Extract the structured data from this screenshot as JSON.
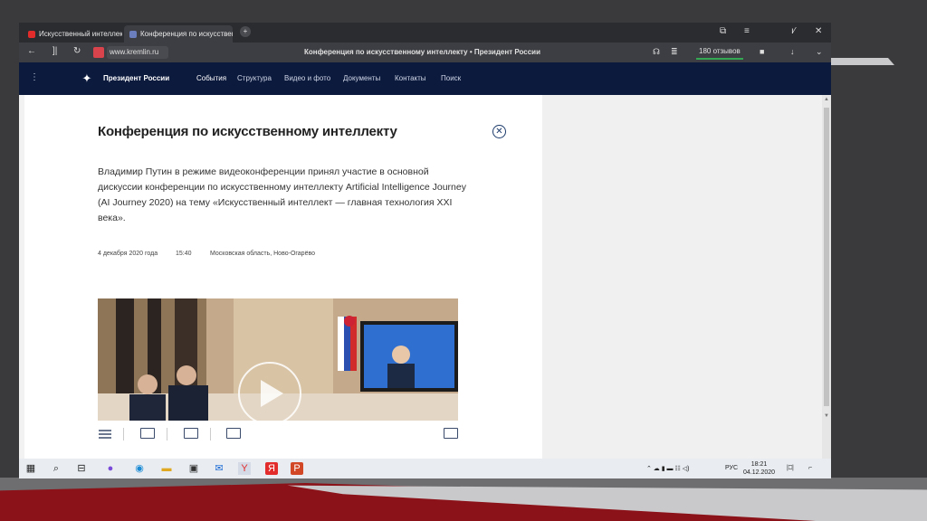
{
  "tabs": [
    {
      "label": "Искусственный интеллект",
      "favicon_color": "#e22b2b"
    },
    {
      "label": "Конференция по искусственному",
      "favicon_color": "#6b7fbf"
    }
  ],
  "address": {
    "url": "www.kremlin.ru",
    "page_title": "Конференция по искусственному интеллекту • Президент России",
    "reviews": "180 отзывов"
  },
  "site": {
    "brand": "Президент России",
    "nav": [
      "События",
      "Структура",
      "Видео и фото",
      "Документы",
      "Контакты",
      "Поиск"
    ]
  },
  "article": {
    "title": "Конференция по искусственному интеллекту",
    "lead": "Владимир Путин в режиме видеоконференции принял участие в основной дискуссии конференции по искусственному интеллекту Artificial Intelligence Journey (AI Journey 2020) на тему «Искусственный интеллект — главная технология XXI века».",
    "date": "4 декабря 2020 года",
    "time": "15:40",
    "place": "Московская область, Ново-Огарёво"
  },
  "taskbar": {
    "lang": "РУС",
    "time": "18:21",
    "date": "04.12.2020"
  },
  "colors": {
    "site_nav_bg": "#0c1a3e",
    "accent_red": "#8b1218",
    "link_blue": "#1b3a6b"
  }
}
